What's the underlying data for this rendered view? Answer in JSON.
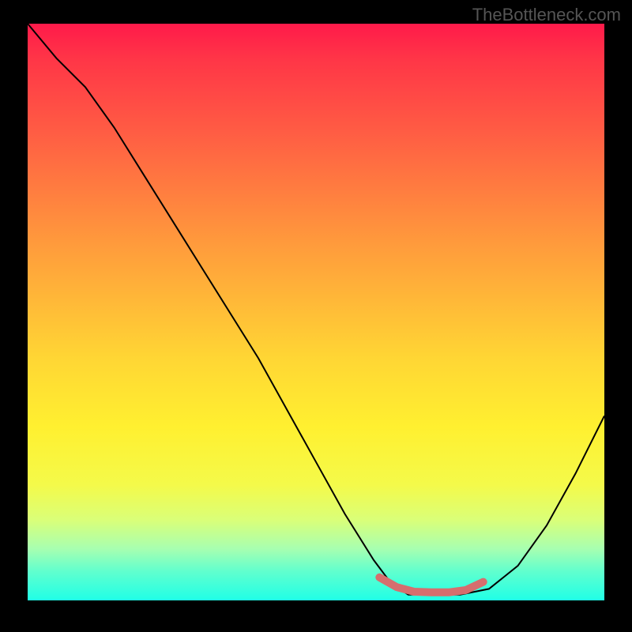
{
  "watermark": "TheBottleneck.com",
  "chart_data": {
    "type": "line",
    "title": "",
    "xlabel": "",
    "ylabel": "",
    "xlim": [
      0,
      100
    ],
    "ylim": [
      0,
      100
    ],
    "grid": false,
    "series": [
      {
        "name": "curve",
        "x": [
          0,
          5,
          10,
          15,
          20,
          25,
          30,
          35,
          40,
          45,
          50,
          55,
          60,
          63,
          66,
          70,
          75,
          80,
          85,
          90,
          95,
          100
        ],
        "values": [
          100,
          94,
          89,
          82,
          74,
          66,
          58,
          50,
          42,
          33,
          24,
          15,
          7,
          3,
          1,
          1,
          1,
          2,
          6,
          13,
          22,
          32
        ]
      },
      {
        "name": "highlight-segment",
        "color": "#d66e6e",
        "x": [
          61,
          64,
          67,
          70,
          73,
          76,
          79
        ],
        "values": [
          4,
          2.3,
          1.5,
          1.4,
          1.4,
          1.8,
          3.2
        ]
      }
    ]
  }
}
